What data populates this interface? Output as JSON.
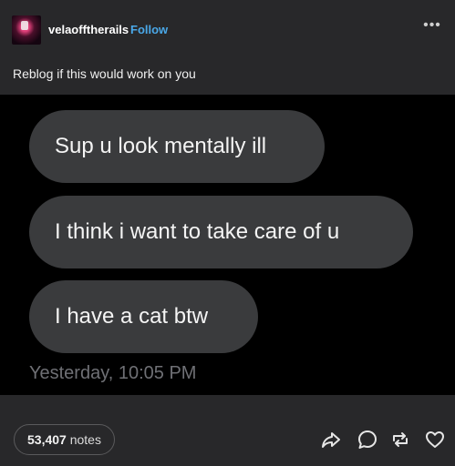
{
  "post": {
    "username": "velaofftherails",
    "follow_label": "Follow",
    "more_label": "•••",
    "caption": "Reblog if this would work on you",
    "image": {
      "messages": [
        "Sup u look mentally ill",
        "I think i want to take care of u",
        "I have a cat btw"
      ],
      "timestamp": "Yesterday, 10:05 PM"
    },
    "footer": {
      "notes_count": "53,407",
      "notes_label": "notes",
      "action_icons": [
        "share-icon",
        "reply-icon",
        "reblog-icon",
        "like-icon"
      ]
    }
  },
  "colors": {
    "background": "#28282a",
    "follow": "#4aa8e8",
    "bubble": "#3a3b3d",
    "timestamp": "#6f7075"
  }
}
